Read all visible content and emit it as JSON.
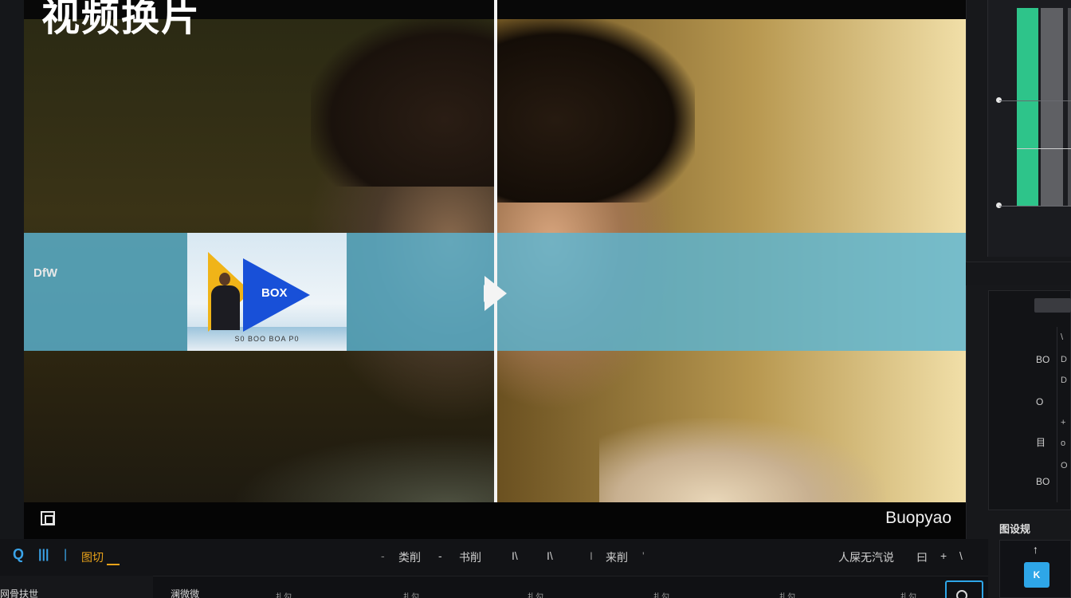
{
  "preview": {
    "title": "视频换片",
    "watermark": "Buopyao",
    "thumbnail": {
      "logo_text": "BOX",
      "caption": "S0 BOO BOA P0"
    }
  },
  "right_panel": {
    "header": "DfW",
    "side_labels": [
      "BO",
      "O",
      "目",
      "BO"
    ],
    "side_col_items": [
      "\\",
      "D",
      "D",
      "+",
      "o",
      "O"
    ],
    "section_label": "图设规",
    "blue_button_label": "K"
  },
  "toolbar": {
    "search_icon": "search-icon",
    "bars_icon": "bars-icon",
    "active_tab": "图切",
    "items": [
      "-",
      "类削",
      "-",
      "书削",
      "I\\",
      "I\\",
      "I",
      "来削",
      "'"
    ],
    "right_items": [
      "人屎无汽说",
      "曰",
      "+",
      "\\"
    ]
  },
  "bottom": {
    "left_label": "网骨扶世",
    "col_header": "澜微微",
    "cols": [
      "扎勾",
      "扎勾",
      "扎勾",
      "扎勾",
      "扎勾",
      "扎勾"
    ]
  },
  "colors": {
    "accent_blue": "#2ea6e8",
    "accent_orange": "#e8a21a",
    "meter_green": "#2ec48a",
    "caption_band": "#5cb4d2"
  }
}
